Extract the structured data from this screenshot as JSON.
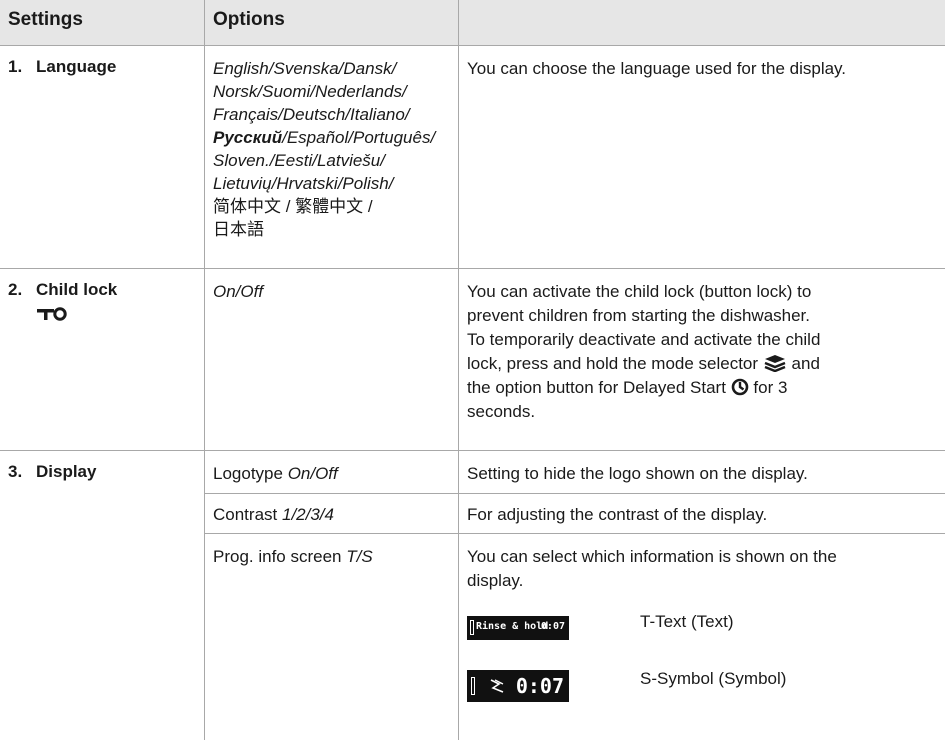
{
  "header": {
    "col1": "Settings",
    "col2": "Options",
    "col3": ""
  },
  "rows": [
    {
      "num": "1.",
      "name": "Language",
      "options": {
        "lines": [
          "English/Svenska/Dansk/",
          "Norsk/Suomi/Nederlands/",
          "Français/Deutsch/Italiano/"
        ],
        "line4_ru": "Русский",
        "line4_rest": "/Español/Português/",
        "lines2": [
          "Sloven./Eesti/Latviešu/",
          "Lietuvių/Hrvatski/Polish/"
        ],
        "cjk1": "简体中文 / 繁體中文 /",
        "cjk2": "日本語"
      },
      "desc": "You can choose the language used for the display."
    },
    {
      "num": "2.",
      "name": "Child lock",
      "icon": "key-icon",
      "options": "On/Off",
      "desc_l1": "You can activate the child lock (button lock) to",
      "desc_l2": "prevent children from starting the dishwasher.",
      "desc_l3": "To temporarily deactivate and activate the child",
      "desc_l4a": "lock, press and hold the mode selector",
      "desc_l4b": "and",
      "desc_l5a": "the option button for Delayed Start",
      "desc_l5b": "for 3",
      "desc_l6": "seconds.",
      "mode_icon": "mode-selector-icon",
      "delay_icon": "clock-icon"
    },
    {
      "num": "3.",
      "name": "Display",
      "sub": [
        {
          "label": "Logotype",
          "value": "On/Off",
          "desc": "Setting to hide the logo shown on the display."
        },
        {
          "label": "Contrast",
          "value": "1/2/3/4",
          "desc": "For adjusting the contrast of the display."
        },
        {
          "label": "Prog. info screen",
          "value": "T/S",
          "desc_l1": "You can select which information is shown on the",
          "desc_l2": "display.",
          "t_lcd_text": "Rinse & hold",
          "t_lcd_time": "0:07",
          "t_caption": "T-Text (Text)",
          "s_lcd_time": "0:07",
          "s_caption": "S-Symbol (Symbol)"
        }
      ]
    }
  ]
}
